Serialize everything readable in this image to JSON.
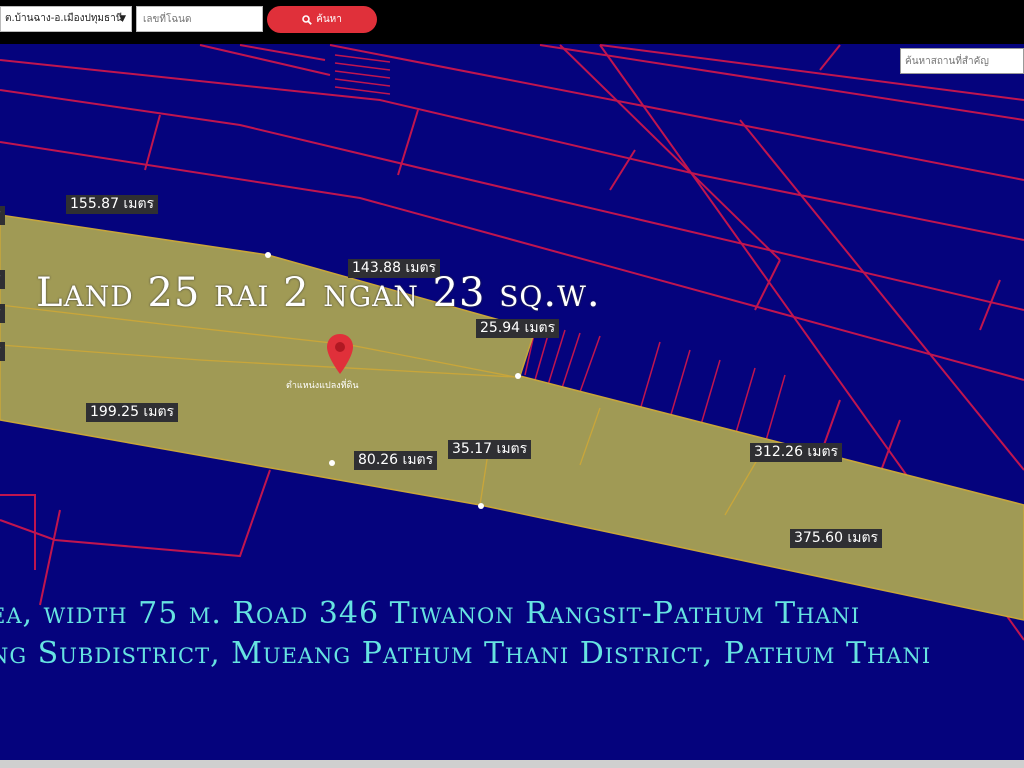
{
  "toolbar": {
    "district_select": "ต.บ้านฉาง-อ.เมืองปทุมธานี",
    "parcel_placeholder": "เลขที่โฉนด",
    "search_label": "ค้นหา"
  },
  "map": {
    "place_search_placeholder": "ค้นหาสถานที่สำคัญ",
    "title": "Land 25 rai 2 ngan 23 sq.w.",
    "caption_lines": [
      "ea, width 75 m. Road 346 Tiwanon Rangsit-Pathum Thani",
      "ng Subdistrict, Mueang Pathum Thani District, Pathum Thani"
    ],
    "marker_label": "ตำแหน่งแปลงที่ดิน",
    "dimension_labels": [
      "155.87 เมตร",
      "143.88 เมตร",
      "25.94 เมตร",
      "199.25 เมตร",
      "80.26 เมตร",
      "35.17 เมตร",
      "312.26 เมตร",
      "375.60 เมตร",
      "ตร",
      "ตร",
      "ตร",
      "ตร"
    ],
    "colors": {
      "background": "#05037d",
      "parcel_lines": "#c0154f",
      "parcel_fill": "#a09a55",
      "caption": "#66e3e1",
      "marker": "#e0303a"
    },
    "icons": [
      "search-icon",
      "location-pin-icon",
      "chevron-down-icon"
    ]
  }
}
